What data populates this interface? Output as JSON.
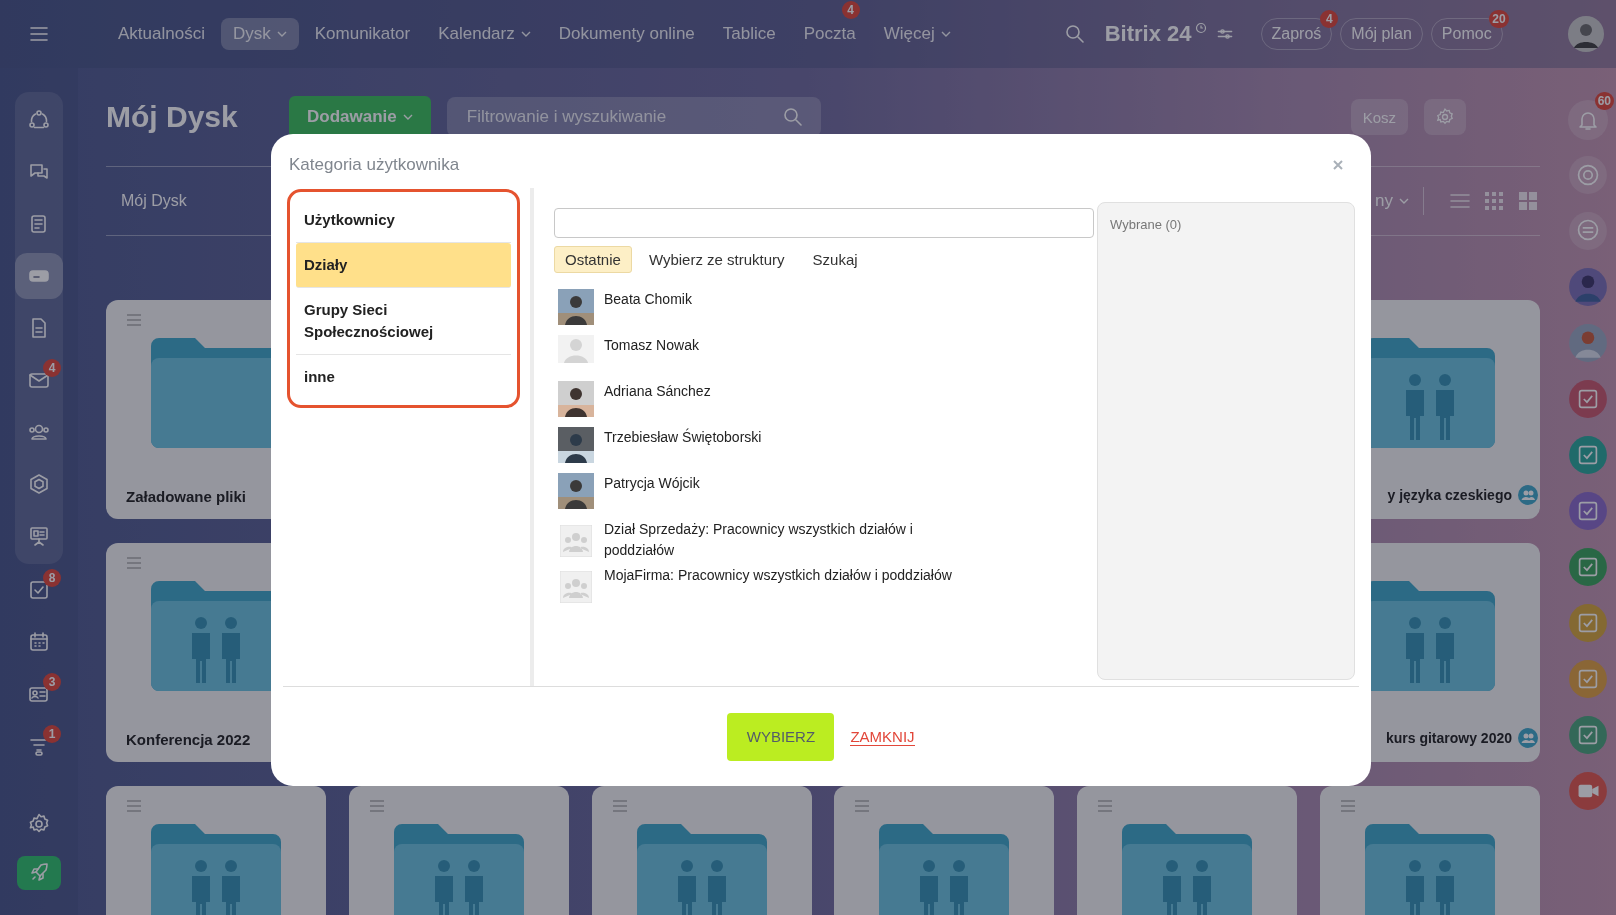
{
  "top_nav": {
    "items": [
      {
        "label": "Aktualności",
        "selected": false,
        "dropdown": false
      },
      {
        "label": "Dysk",
        "selected": true,
        "dropdown": true
      },
      {
        "label": "Komunikator",
        "selected": false,
        "dropdown": false
      },
      {
        "label": "Kalendarz",
        "selected": false,
        "dropdown": true
      },
      {
        "label": "Dokumenty online",
        "selected": false,
        "dropdown": false
      },
      {
        "label": "Tablice",
        "selected": false,
        "dropdown": false
      },
      {
        "label": "Poczta",
        "selected": false,
        "dropdown": false,
        "badge": "4"
      },
      {
        "label": "Więcej",
        "selected": false,
        "dropdown": true
      }
    ],
    "logo": "Bitrix 24",
    "buttons": [
      {
        "label": "Zaproś",
        "badge": "4"
      },
      {
        "label": "Mój plan"
      },
      {
        "label": "Pomoc",
        "badge": "20"
      }
    ]
  },
  "sidebar": {
    "items": [
      {
        "selected": false
      },
      {
        "selected": false
      },
      {
        "selected": false
      },
      {
        "selected": true
      },
      {
        "selected": false
      },
      {
        "selected": false,
        "badge": "4"
      },
      {
        "selected": false
      },
      {
        "selected": false
      },
      {
        "selected": false
      },
      {
        "selected": false,
        "badge": "8"
      },
      {
        "selected": false
      },
      {
        "selected": false,
        "badge": "3"
      },
      {
        "selected": false,
        "badge": "1"
      }
    ]
  },
  "right_rail": {
    "notifications_badge": "60"
  },
  "page": {
    "title": "Mój Dysk",
    "add_button": "Dodawanie",
    "search": {
      "placeholder": "Filtrowanie i wyszukiwanie"
    },
    "trash_button": "Kosz",
    "breadcrumb": "Mój Dysk",
    "sort_label": "ny"
  },
  "folder_rows": [
    [
      {
        "name": "Załadowane pliki",
        "kind": "plain",
        "shared": false
      },
      {
        "name": "y języka czeskiego",
        "kind": "group",
        "shared": true
      }
    ],
    [
      {
        "name": "Konferencja 2022",
        "kind": "group",
        "shared": false
      },
      {
        "name": "kurs gitarowy 2020",
        "kind": "group",
        "shared": true
      }
    ],
    [
      {
        "kind": "group",
        "shared": false
      },
      {
        "kind": "group",
        "shared": false
      },
      {
        "kind": "group",
        "shared": false
      },
      {
        "kind": "group",
        "shared": false
      },
      {
        "kind": "group",
        "shared": false
      },
      {
        "kind": "group",
        "shared": false
      }
    ]
  ],
  "dialog": {
    "title": "Kategoria użytkownika",
    "categories": [
      {
        "label": "Użytkownicy",
        "selected": false
      },
      {
        "label": "Działy",
        "selected": true
      },
      {
        "label": "Grupy Sieci Społecznościowej",
        "selected": false
      },
      {
        "label": "inne",
        "selected": false
      }
    ],
    "tabs": [
      {
        "label": "Ostatnie",
        "selected": true
      },
      {
        "label": "Wybierz ze struktury",
        "selected": false
      },
      {
        "label": "Szukaj",
        "selected": false
      }
    ],
    "entries": [
      {
        "name": "Beata Chomik"
      },
      {
        "name": "Tomasz Nowak",
        "kind": "placeholder"
      },
      {
        "name": "Adriana Sánchez"
      },
      {
        "name": "Trzebiesław Świętoborski"
      },
      {
        "name": "Patrycja Wójcik"
      },
      {
        "name": "Dział Sprzedaży: Pracownicy wszystkich działów i\npoddziałów",
        "kind": "department"
      },
      {
        "name": "MojaFirma: Pracownicy wszystkich działów i poddziałów",
        "kind": "department"
      }
    ],
    "selected_label": "Wybrane (0)",
    "ok_button": "WYBIERZ",
    "close_link": "ZAMKNIJ"
  }
}
